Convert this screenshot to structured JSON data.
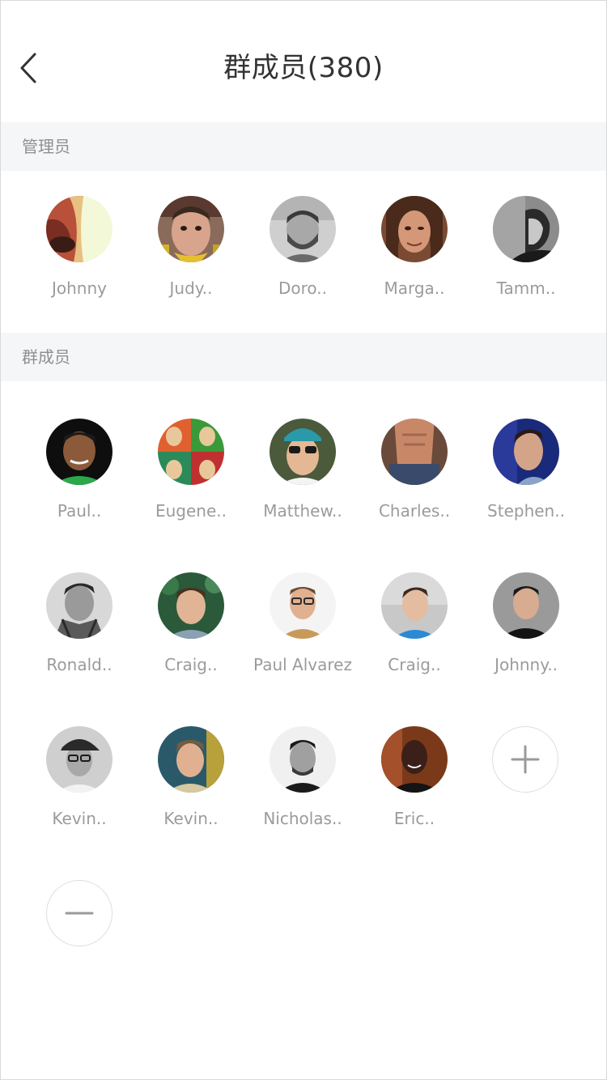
{
  "header": {
    "title": "群成员(380)",
    "back_icon": "chevron-left-icon"
  },
  "sections": {
    "admins_label": "管理员",
    "members_label": "群成员"
  },
  "admins": [
    {
      "name": "Johnny"
    },
    {
      "name": "Judy.."
    },
    {
      "name": "Doro.."
    },
    {
      "name": "Marga.."
    },
    {
      "name": "Tamm.."
    }
  ],
  "members": [
    {
      "name": "Paul.."
    },
    {
      "name": "Eugene.."
    },
    {
      "name": "Matthew.."
    },
    {
      "name": "Charles.."
    },
    {
      "name": "Stephen.."
    },
    {
      "name": "Ronald.."
    },
    {
      "name": "Craig.."
    },
    {
      "name": "Paul Alvarez"
    },
    {
      "name": "Craig.."
    },
    {
      "name": "Johnny.."
    },
    {
      "name": "Kevin.."
    },
    {
      "name": "Kevin.."
    },
    {
      "name": "Nicholas.."
    },
    {
      "name": "Eric.."
    }
  ],
  "actions": {
    "add_icon": "plus-icon",
    "remove_icon": "minus-icon"
  },
  "colors": {
    "title_text": "#333333",
    "name_text": "#9b9b9b",
    "section_bg": "#f5f6f8",
    "section_text": "#8f8f8f"
  }
}
